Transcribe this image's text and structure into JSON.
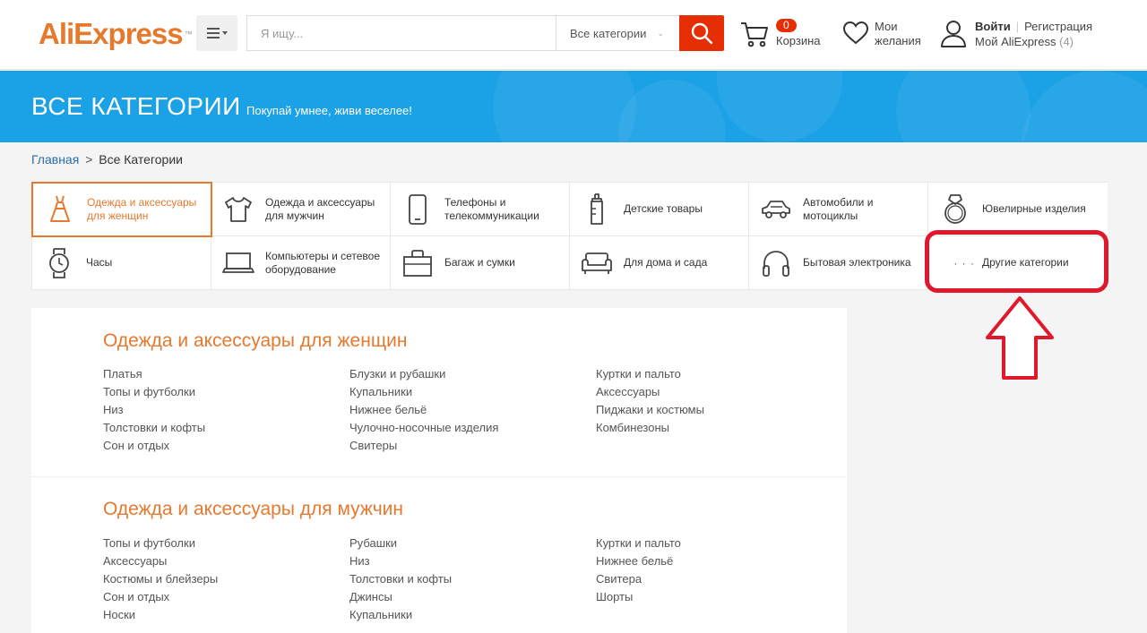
{
  "header": {
    "logo_text": "AliExpress",
    "logo_tm": "™",
    "search_placeholder": "Я ищу...",
    "search_category": "Все категории",
    "cart_count": "0",
    "cart_label": "Корзина",
    "wishlist_label_1": "Мои",
    "wishlist_label_2": "желания",
    "login": "Войти",
    "register": "Регистрация",
    "my_account": "Мой AliExpress",
    "my_account_count": "(4)"
  },
  "banner": {
    "title": "ВСЕ КАТЕГОРИИ",
    "subtitle": "Покупай умнее, живи веселее!"
  },
  "breadcrumb": {
    "home": "Главная",
    "separator": ">",
    "current": "Все Категории"
  },
  "categories": [
    {
      "label": "Одежда и аксессуары для женщин",
      "icon": "dress-icon",
      "active": true
    },
    {
      "label": "Одежда и аксессуары для мужчин",
      "icon": "tshirt-icon"
    },
    {
      "label": "Телефоны и телекоммуникации",
      "icon": "phone-icon"
    },
    {
      "label": "Детские товары",
      "icon": "baby-bottle-icon"
    },
    {
      "label": "Автомобили и мотоциклы",
      "icon": "car-icon"
    },
    {
      "label": "Ювелирные изделия",
      "icon": "ring-icon"
    },
    {
      "label": "Часы",
      "icon": "watch-icon"
    },
    {
      "label": "Компьютеры и сетевое оборудование",
      "icon": "laptop-icon"
    },
    {
      "label": "Багаж и сумки",
      "icon": "bag-icon"
    },
    {
      "label": "Для дома и сада",
      "icon": "sofa-icon"
    },
    {
      "label": "Бытовая электроника",
      "icon": "headphones-icon"
    },
    {
      "label": "Другие категории",
      "icon": "more-dots-icon",
      "dots": "· · ·"
    }
  ],
  "sections": [
    {
      "title": "Одежда и аксессуары для женщин",
      "columns": [
        [
          "Платья",
          "Топы и футболки",
          "Низ",
          "Толстовки и кофты",
          "Сон и отдых"
        ],
        [
          "Блузки и рубашки",
          "Купальники",
          "Нижнее бельё",
          "Чулочно-носочные изделия",
          "Свитеры"
        ],
        [
          "Куртки и пальто",
          "Аксессуары",
          "Пиджаки и костюмы",
          "Комбинезоны"
        ]
      ]
    },
    {
      "title": "Одежда и аксессуары для мужчин",
      "columns": [
        [
          "Топы и футболки",
          "Аксессуары",
          "Костюмы и блейзеры",
          "Сон и отдых",
          "Носки"
        ],
        [
          "Рубашки",
          "Низ",
          "Толстовки и кофты",
          "Джинсы",
          "Купальники"
        ],
        [
          "Куртки и пальто",
          "Нижнее бельё",
          "Свитера",
          "Шорты"
        ]
      ]
    }
  ],
  "colors": {
    "accent": "#e6792e",
    "search_button": "#e62e04",
    "banner": "#1ba1e6",
    "annotation": "#e0182b"
  }
}
